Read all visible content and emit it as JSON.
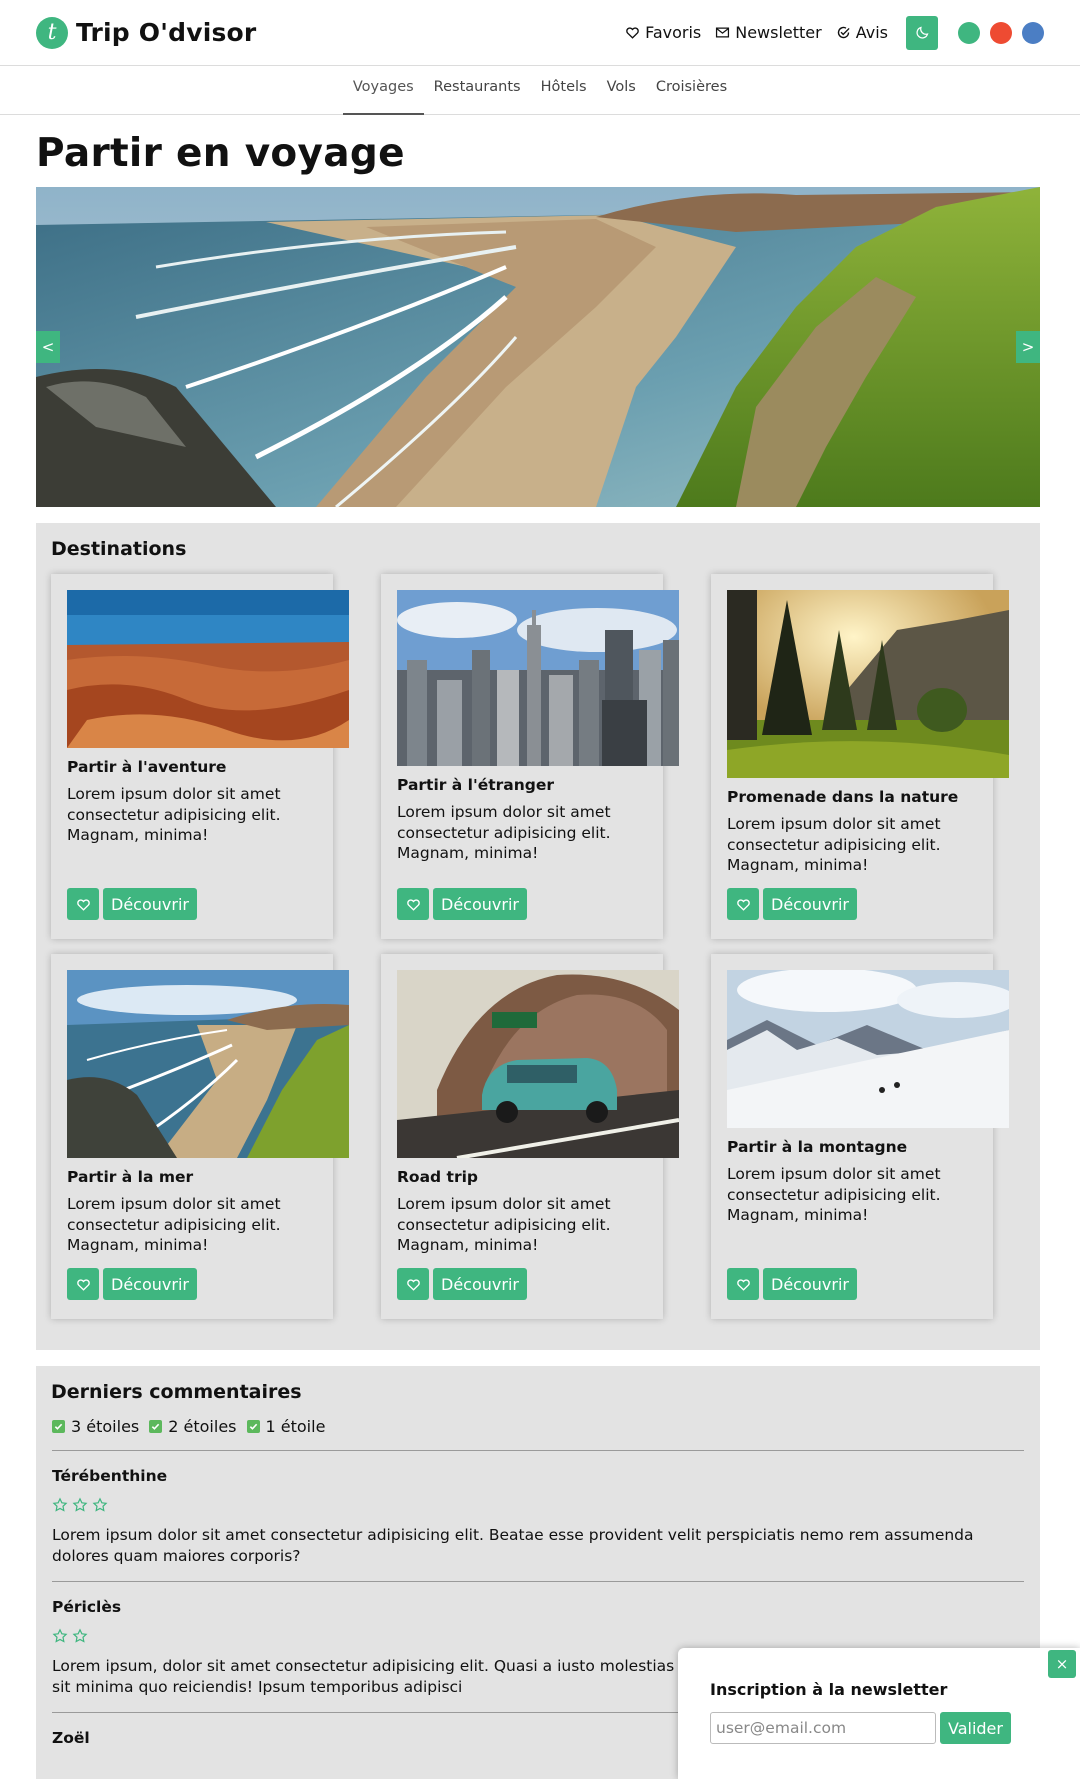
{
  "app": {
    "logo_letter": "t",
    "name": "Trip O'dvisor"
  },
  "header": {
    "links": [
      {
        "label": "Favoris",
        "icon": "heart-icon"
      },
      {
        "label": "Newsletter",
        "icon": "envelope-icon"
      },
      {
        "label": "Avis",
        "icon": "check-circle-icon"
      }
    ],
    "dark_mode_icon": "moon-icon",
    "theme_colors": [
      "#3fb680",
      "#ee4b32",
      "#4b7ec4"
    ]
  },
  "nav": {
    "tabs": [
      "Voyages",
      "Restaurants",
      "Hôtels",
      "Vols",
      "Croisières"
    ],
    "active": "Voyages"
  },
  "page": {
    "title": "Partir en voyage"
  },
  "carousel": {
    "prev": "<",
    "next": ">"
  },
  "destinations": {
    "title": "Destinations",
    "cards": [
      {
        "title": "Partir à l'aventure",
        "text": "Lorem ipsum dolor sit amet consectetur adipisicing elit. Magnam, minima!",
        "button": "Découvrir",
        "image": "desert-canyon"
      },
      {
        "title": "Partir à l'étranger",
        "text": "Lorem ipsum dolor sit amet consectetur adipisicing elit. Magnam, minima!",
        "button": "Découvrir",
        "image": "city-skyline"
      },
      {
        "title": "Promenade dans la nature",
        "text": "Lorem ipsum dolor sit amet consectetur adipisicing elit. Magnam, minima!",
        "button": "Découvrir",
        "image": "forest-sunset"
      },
      {
        "title": "Partir à la mer",
        "text": "Lorem ipsum dolor sit amet consectetur adipisicing elit. Magnam, minima!",
        "button": "Découvrir",
        "image": "beach-coast"
      },
      {
        "title": "Road trip",
        "text": "Lorem ipsum dolor sit amet consectetur adipisicing elit. Magnam, minima!",
        "button": "Découvrir",
        "image": "vintage-car"
      },
      {
        "title": "Partir à la montagne",
        "text": "Lorem ipsum dolor sit amet consectetur adipisicing elit. Magnam, minima!",
        "button": "Découvrir",
        "image": "snowy-mountain"
      }
    ]
  },
  "comments": {
    "title": "Derniers commentaires",
    "filters": [
      "3 étoiles",
      "2 étoiles",
      "1 étoile"
    ],
    "items": [
      {
        "author": "Térébenthine",
        "stars": 3,
        "text": "Lorem ipsum dolor sit amet consectetur adipisicing elit. Beatae esse provident velit perspiciatis nemo rem assumenda dolores quam maiores corporis?"
      },
      {
        "author": "Périclès",
        "stars": 2,
        "text": "Lorem ipsum, dolor sit amet consectetur adipisicing elit. Quasi a iusto molestias voluptatem neque similique ipsum, quam sit minima quo reiciendis! Ipsum temporibus adipisci"
      },
      {
        "author": "Zoël"
      }
    ]
  },
  "newsletter_popup": {
    "close": "×",
    "title": "Inscription à la newsletter",
    "placeholder": "user@email.com",
    "submit": "Valider"
  },
  "colors": {
    "accent": "#3fb680",
    "panel": "#e3e3e3",
    "star": "#3fb680"
  }
}
